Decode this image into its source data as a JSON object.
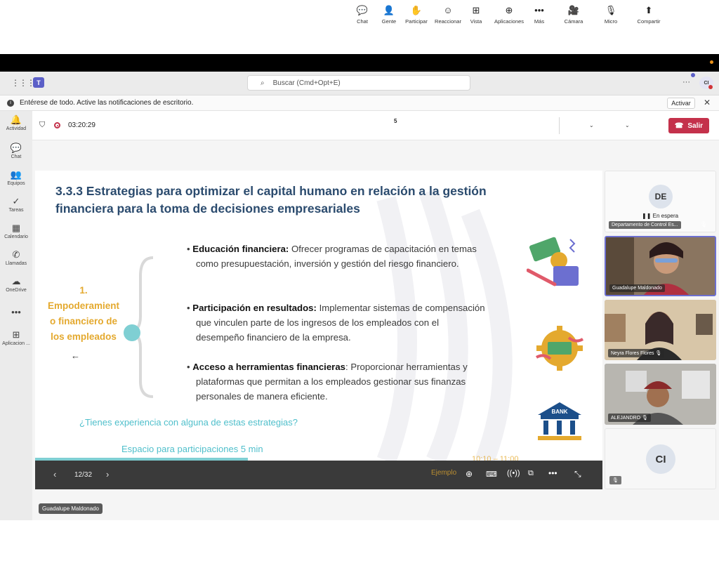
{
  "topbar": {
    "search_placeholder": "Buscar (Cmd+Opt+E)",
    "user_initials": "CI"
  },
  "notification": {
    "text": "Entérese de todo. Active las notificaciones de escritorio.",
    "action": "Activar"
  },
  "rail": [
    {
      "label": "Actividad",
      "icon": "bell-icon",
      "glyph": "🔔"
    },
    {
      "label": "Chat",
      "icon": "chat-icon",
      "glyph": "💬"
    },
    {
      "label": "Equipos",
      "icon": "teams-icon",
      "glyph": "👥"
    },
    {
      "label": "Tareas",
      "icon": "tasks-icon",
      "glyph": "✓"
    },
    {
      "label": "Calendario",
      "icon": "calendar-icon",
      "glyph": "▦"
    },
    {
      "label": "Llamadas",
      "icon": "phone-icon",
      "glyph": "✆"
    },
    {
      "label": "OneDrive",
      "icon": "cloud-icon",
      "glyph": "☁"
    },
    {
      "label": "",
      "icon": "more-icon",
      "glyph": "•••"
    },
    {
      "label": "Aplicacion ...",
      "icon": "apps-icon",
      "glyph": "⊞"
    }
  ],
  "meeting": {
    "timer": "03:20:29",
    "people_count": "5",
    "tools": [
      {
        "label": "Chat",
        "icon": "chat-icon",
        "glyph": "💬"
      },
      {
        "label": "Gente",
        "icon": "people-icon",
        "glyph": "👤"
      },
      {
        "label": "Participar",
        "icon": "hand-icon",
        "glyph": "✋"
      },
      {
        "label": "Reaccionar",
        "icon": "emoji-icon",
        "glyph": "☺"
      },
      {
        "label": "Vista",
        "icon": "view-icon",
        "glyph": "⊞"
      },
      {
        "label": "Aplicaciones",
        "icon": "add-app-icon",
        "glyph": "⊕"
      },
      {
        "label": "Más",
        "icon": "more-icon",
        "glyph": "•••"
      },
      {
        "label": "Cámara",
        "icon": "camera-off-icon",
        "glyph": "🎥"
      },
      {
        "label": "Micro",
        "icon": "mic-off-icon",
        "glyph": "🎙"
      },
      {
        "label": "Compartir",
        "icon": "share-icon",
        "glyph": "⬆"
      }
    ],
    "leave": "Salir"
  },
  "slide": {
    "title_line1": "3.3.3 Estrategias para optimizar el capital humano en relación a la gestión",
    "title_line2": "financiera para la toma de decisiones empresariales",
    "left_lines": [
      "1.",
      "Empoderamient",
      "o financiero de",
      "los empleados"
    ],
    "bullets": [
      {
        "bold": "Educación financiera:",
        "text": " Ofrecer programas de capacitación en temas como presupuestación, inversión y gestión del riesgo financiero."
      },
      {
        "bold": "Participación en resultados:",
        "text": " Implementar sistemas de compensación que vinculen parte de los ingresos de los empleados con el desempeño financiero de la empresa."
      },
      {
        "bold": "Acceso a herramientas financieras",
        "text": ": Proporcionar herramientas y plataformas que permitan a los empleados gestionar sus finanzas personales de manera eficiente."
      }
    ],
    "question": "¿Tienes experiencia con alguna de estas estrategias?",
    "space": "Espacio para participaciones 5 min",
    "bank_label": "BANK",
    "time_overlap": "10:10 – 11:00",
    "example_overlap": "Ejemplo"
  },
  "slide_controls": {
    "page": "12/32"
  },
  "participants": [
    {
      "initials": "DE",
      "status": "En espera",
      "name": "Departamento de Control Es..."
    },
    {
      "name": "Guadalupe Maldonado"
    },
    {
      "name": "Neyra Flores Flores"
    },
    {
      "name": "ALEJANDRO"
    },
    {
      "initials": "CI"
    }
  ],
  "presenter_chip": "Guadalupe Maldonado",
  "colors": {
    "accent_teal": "#4fbfcb",
    "title_blue": "#2b4b6e",
    "gold": "#e4a92e",
    "leave_red": "#c4314b",
    "teams_purple": "#5b5fc7"
  }
}
